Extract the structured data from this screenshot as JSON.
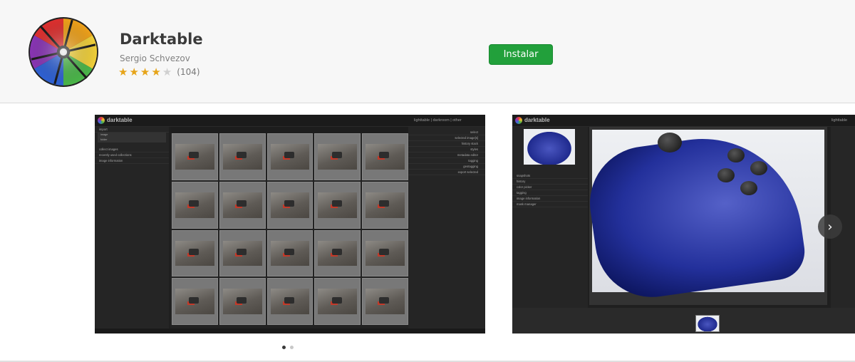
{
  "app": {
    "name": "Darktable",
    "developer": "Sergio Schvezov",
    "rating": 4,
    "rating_max": 5,
    "review_count": "(104)",
    "install_label": "Instalar",
    "logo_icon": "darktable-aperture-logo"
  },
  "colors": {
    "install_button": "#22a03b",
    "star_on": "#e6a419",
    "star_off": "#d0d0d0",
    "header_bg": "#f7f7f7"
  },
  "screenshots": [
    {
      "name": "darktable",
      "views": "lighttable | darkroom | other",
      "left_panel": [
        "import",
        "image",
        "folder",
        "collect images",
        "recently used collections",
        "image information"
      ],
      "right_panel": [
        "select",
        "selected image[s]",
        "history stack",
        "styles",
        "metadata editor",
        "tagging",
        "geotagging",
        "export selected"
      ]
    },
    {
      "name": "darktable",
      "views": "lighttable",
      "left_panel": [
        "snapshots",
        "history",
        "color picker",
        "tagging",
        "image information",
        "mask manager"
      ]
    }
  ],
  "carousel": {
    "active_index": 0,
    "total": 2,
    "next_icon": "chevron-right-icon",
    "next_symbol": "›"
  }
}
